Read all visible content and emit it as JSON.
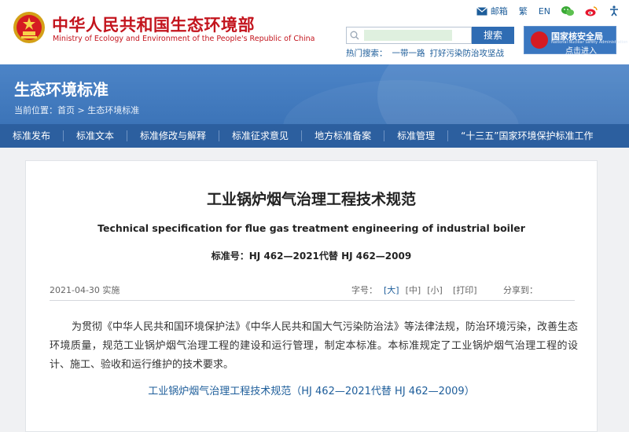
{
  "site": {
    "name_cn": "中华人民共和国生态环境部",
    "name_en": "Ministry of Ecology and Environment of the People's Republic of China"
  },
  "top_links": {
    "mail": "邮箱",
    "traditional": "繁",
    "english": "EN"
  },
  "search": {
    "placeholder": "",
    "button": "搜索",
    "hot_label": "热门搜索：",
    "hot_items": [
      "一带一路",
      "打好污染防治攻坚战"
    ]
  },
  "nnsa": {
    "title": "国家核安全局",
    "subtitle": "National Nuclear Safety Administration",
    "enter": "点击进入"
  },
  "banner": {
    "title": "生态环境标准",
    "breadcrumb": "当前位置：首页 > 生态环境标准"
  },
  "nav": {
    "items": [
      "标准发布",
      "标准文本",
      "标准修改与解释",
      "标准征求意见",
      "地方标准备案",
      "标准管理",
      "“十三五”国家环境保护标准工作"
    ]
  },
  "document": {
    "title": "工业锅炉烟气治理工程技术规范",
    "title_en": "Technical specification for flue gas treatment engineering of industrial boiler",
    "standard_no": "标准号：HJ 462—2021代替 HJ 462—2009",
    "date": "2021-04-30 实施",
    "font_label": "字号：",
    "font_large": "[大]",
    "font_medium": "[中]",
    "font_small": "[小]",
    "print": "[打印]",
    "share": "分享到：",
    "body": "为贯彻《中华人民共和国环境保护法》《中华人民共和国大气污染防治法》等法律法规，防治环境污染，改善生态环境质量，规范工业锅炉烟气治理工程的建设和运行管理，制定本标准。本标准规定了工业锅炉烟气治理工程的设计、施工、验收和运行维护的技术要求。",
    "link": "工业锅炉烟气治理工程技术规范（HJ 462—2021代替 HJ 462—2009）"
  },
  "colors": {
    "brand_red": "#c3141d",
    "nav_blue": "#2c5f9f",
    "banner_blue": "#4c84c7",
    "link_blue": "#1d5d9a"
  }
}
